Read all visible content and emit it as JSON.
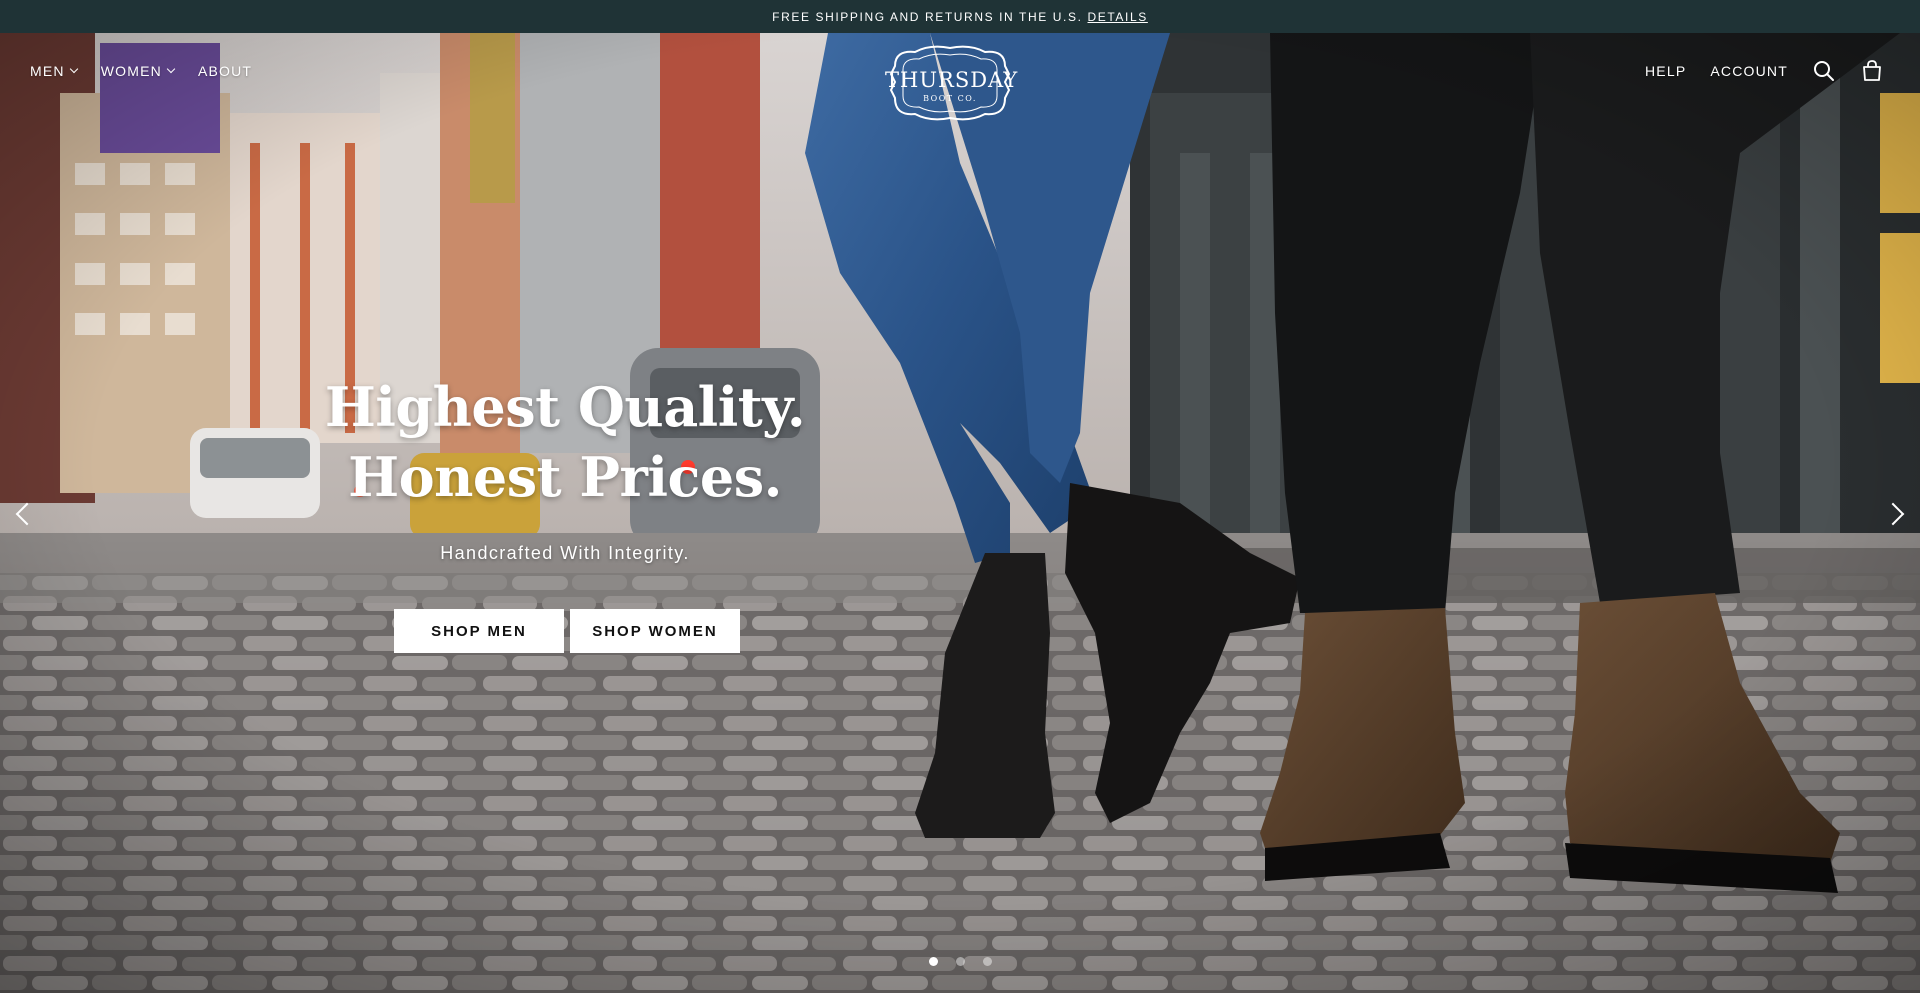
{
  "announcement": {
    "text": "FREE SHIPPING AND RETURNS IN THE U.S.",
    "link_label": "DETAILS"
  },
  "brand": {
    "name": "THURSDAY",
    "sub": "BOOT CO."
  },
  "nav": {
    "left": [
      {
        "label": "MEN",
        "dropdown": true
      },
      {
        "label": "WOMEN",
        "dropdown": true
      },
      {
        "label": "ABOUT",
        "dropdown": false
      }
    ],
    "right": [
      {
        "label": "HELP"
      },
      {
        "label": "ACCOUNT"
      }
    ],
    "icons": [
      "search-icon",
      "cart-icon"
    ]
  },
  "hero": {
    "headline_line1": "Highest Quality.",
    "headline_line2": "Honest Prices.",
    "subhead": "Handcrafted With Integrity.",
    "cta_men": "SHOP MEN",
    "cta_women": "SHOP WOMEN"
  },
  "carousel": {
    "slide_count": 3,
    "active_slide": 1
  },
  "colors": {
    "announcement_bg": "#1f3336",
    "text_light": "#ffffff",
    "button_bg": "#ffffff",
    "button_text": "#111111"
  }
}
